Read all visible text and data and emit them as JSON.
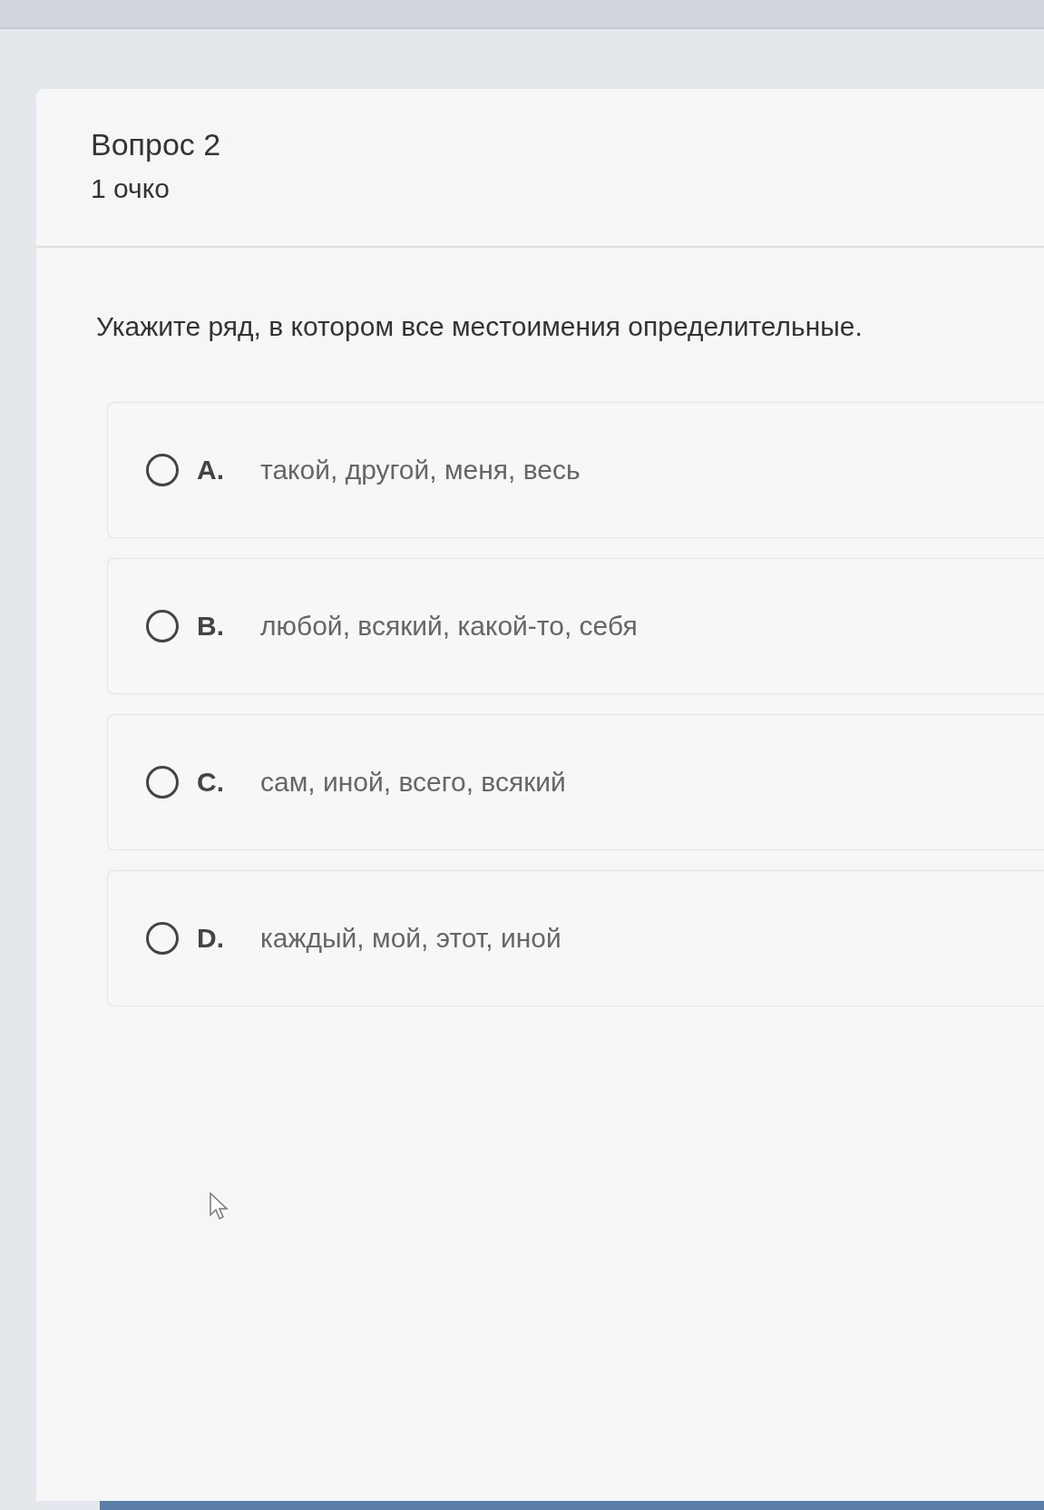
{
  "question": {
    "title": "Вопрос 2",
    "points": "1 очко",
    "text": "Укажите ряд, в котором все местоимения определительные."
  },
  "options": [
    {
      "letter": "A.",
      "text": "такой, другой, меня, весь",
      "selected": false
    },
    {
      "letter": "B.",
      "text": "любой, всякий, какой-то, себя",
      "selected": false
    },
    {
      "letter": "C.",
      "text": "сам, иной, всего, всякий",
      "selected": false
    },
    {
      "letter": "D.",
      "text": "каждый, мой, этот, иной",
      "selected": false
    }
  ]
}
